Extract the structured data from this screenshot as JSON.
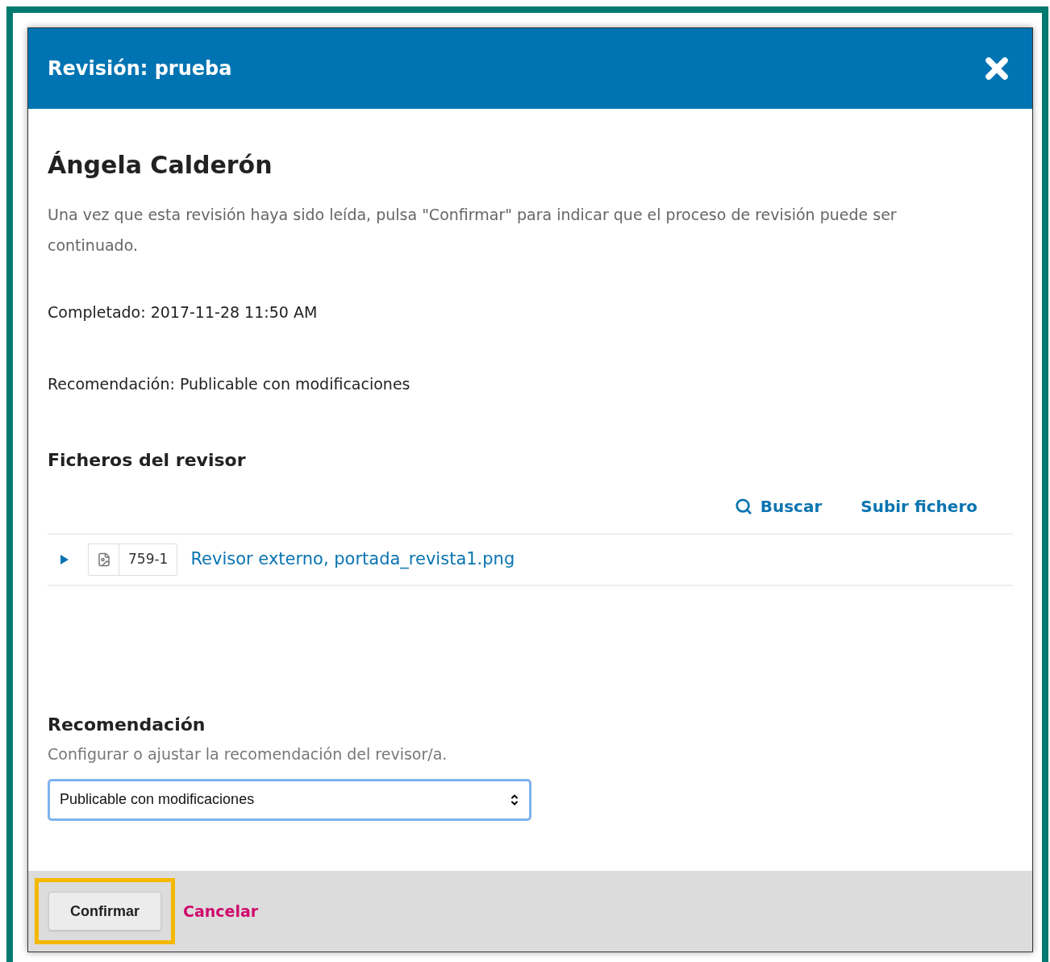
{
  "modal": {
    "title": "Revisión: prueba"
  },
  "reviewer": {
    "name": "Ángela Calderón",
    "instructions": "Una vez que esta revisión haya sido leída, pulsa \"Confirmar\" para indicar que el proceso de revisión puede ser continuado.",
    "completed": "Completado: 2017-11-28 11:50 AM",
    "recommendation": "Recomendación: Publicable con modificaciones"
  },
  "files": {
    "heading": "Ficheros del revisor",
    "actions": [
      "Buscar",
      "Subir fichero"
    ],
    "rows": [
      {
        "expanded": false,
        "id": "759-1",
        "name": "Revisor externo, portada_revista1.png"
      }
    ]
  },
  "recommendation_form": {
    "heading": "Recomendación",
    "description": "Configurar o ajustar la recomendación del revisor/a.",
    "value": "Publicable con modificaciones"
  },
  "footer": {
    "confirm": {
      "label": "Confirmar",
      "highlighted": true
    },
    "cancel": "Cancelar"
  }
}
